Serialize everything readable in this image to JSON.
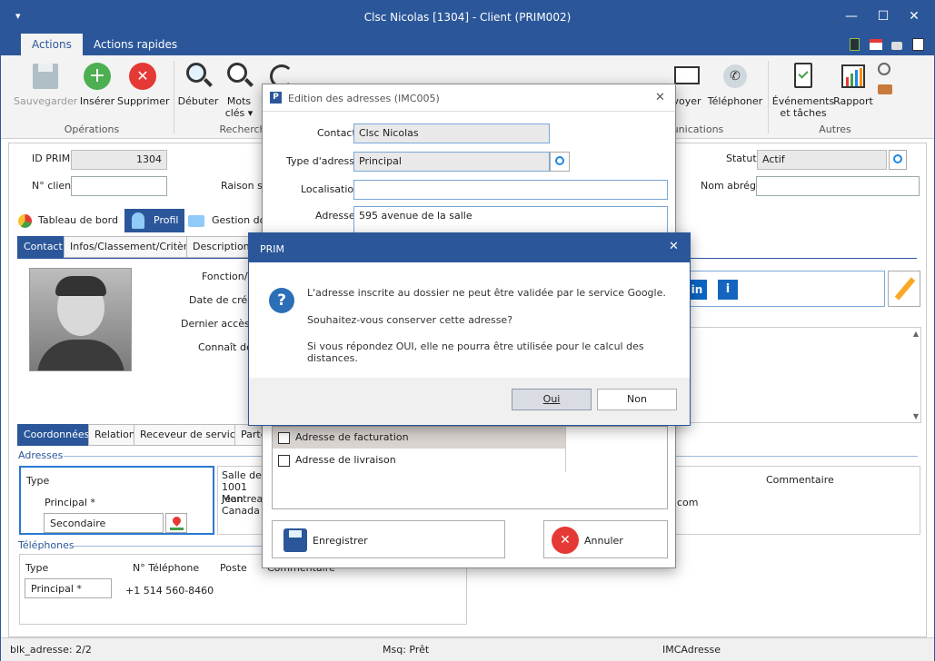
{
  "window": {
    "title": "Clsc Nicolas [1304] - Client (PRIM002)",
    "min": "—",
    "max": "☐",
    "close": "✕"
  },
  "menu": {
    "tabs": [
      "Actions",
      "Actions rapides"
    ]
  },
  "ribbon": {
    "buttons": {
      "save": "Sauvegarder",
      "insert": "Insérer",
      "delete": "Supprimer",
      "start": "Débuter",
      "keywords": "Mots clés ▾",
      "call": "voyer",
      "phone": "Téléphoner",
      "events": "Événements et tâches",
      "report": "Rapport"
    },
    "groups": {
      "operations": "Opérations",
      "search": "Recherch",
      "communications": "unications",
      "others": "Autres"
    }
  },
  "form": {
    "id_label": "ID PRIM",
    "id_value": "1304",
    "client_label": "N° client",
    "client_value": "",
    "raison_label": "Raison so",
    "statut_label": "Statut",
    "statut_value": "Actif",
    "nom_abrege_label": "Nom abrégé",
    "nom_abrege_value": "",
    "fonction_label": "Fonction/Ti",
    "date_label": "Date de créat",
    "dernier_label": "Dernier accès W",
    "connait_label": "Connaît dep"
  },
  "tabs1": [
    "Tableau de bord",
    "Profil",
    "Gestion doc"
  ],
  "tabs2": [
    "Contact",
    "Infos/Classement/Critères",
    "Description"
  ],
  "tabs3": [
    "Coordonnées",
    "Relation",
    "Receveur de service",
    "Parte"
  ],
  "addresses": {
    "section": "Adresses",
    "col_type": "Type",
    "row1": "Principal *",
    "row2": "Secondaire",
    "line1": "Salle de c",
    "line2": "1001 Jean",
    "line3": "Montreal",
    "line4": "Canada",
    "comment_col": "Commentaire",
    "email_frag": "com"
  },
  "phones": {
    "section": "Téléphones",
    "col_type": "Type",
    "col_num": "N° Téléphone",
    "col_poste": "Poste",
    "col_comment": "Commentaire",
    "row_type": "Principal *",
    "row_num": "+1 514 560-8460"
  },
  "status": {
    "left": "blk_adresse: 2/2",
    "mid": "Msq: Prêt",
    "right": "IMCAdresse"
  },
  "address_dialog": {
    "title": "Edition des adresses (IMC005)",
    "close": "✕",
    "contact_label": "Contact",
    "contact_value": "Clsc Nicolas",
    "type_label": "Type d'adresse",
    "type_value": "Principal",
    "loc_label": "Localisation",
    "loc_value": "",
    "adresse_label": "Adresse",
    "adresse_value": "595 avenue de la salle",
    "chk_facturation": "Adresse de facturation",
    "chk_livraison": "Adresse de livraison",
    "save": "Enregistrer",
    "cancel": "Annuler"
  },
  "prim_dialog": {
    "title": "PRIM",
    "close": "✕",
    "line1": "L'adresse inscrite au dossier ne peut être validée par le service Google.",
    "line2": "Souhaitez-vous conserver cette adresse?",
    "line3": "Si vous répondez OUI, elle ne pourra être utilisée pour le calcul des distances.",
    "yes": "Oui",
    "no": "Non"
  },
  "colors": {
    "accent": "#2b579a",
    "danger": "#e53935",
    "success": "#43a047"
  }
}
